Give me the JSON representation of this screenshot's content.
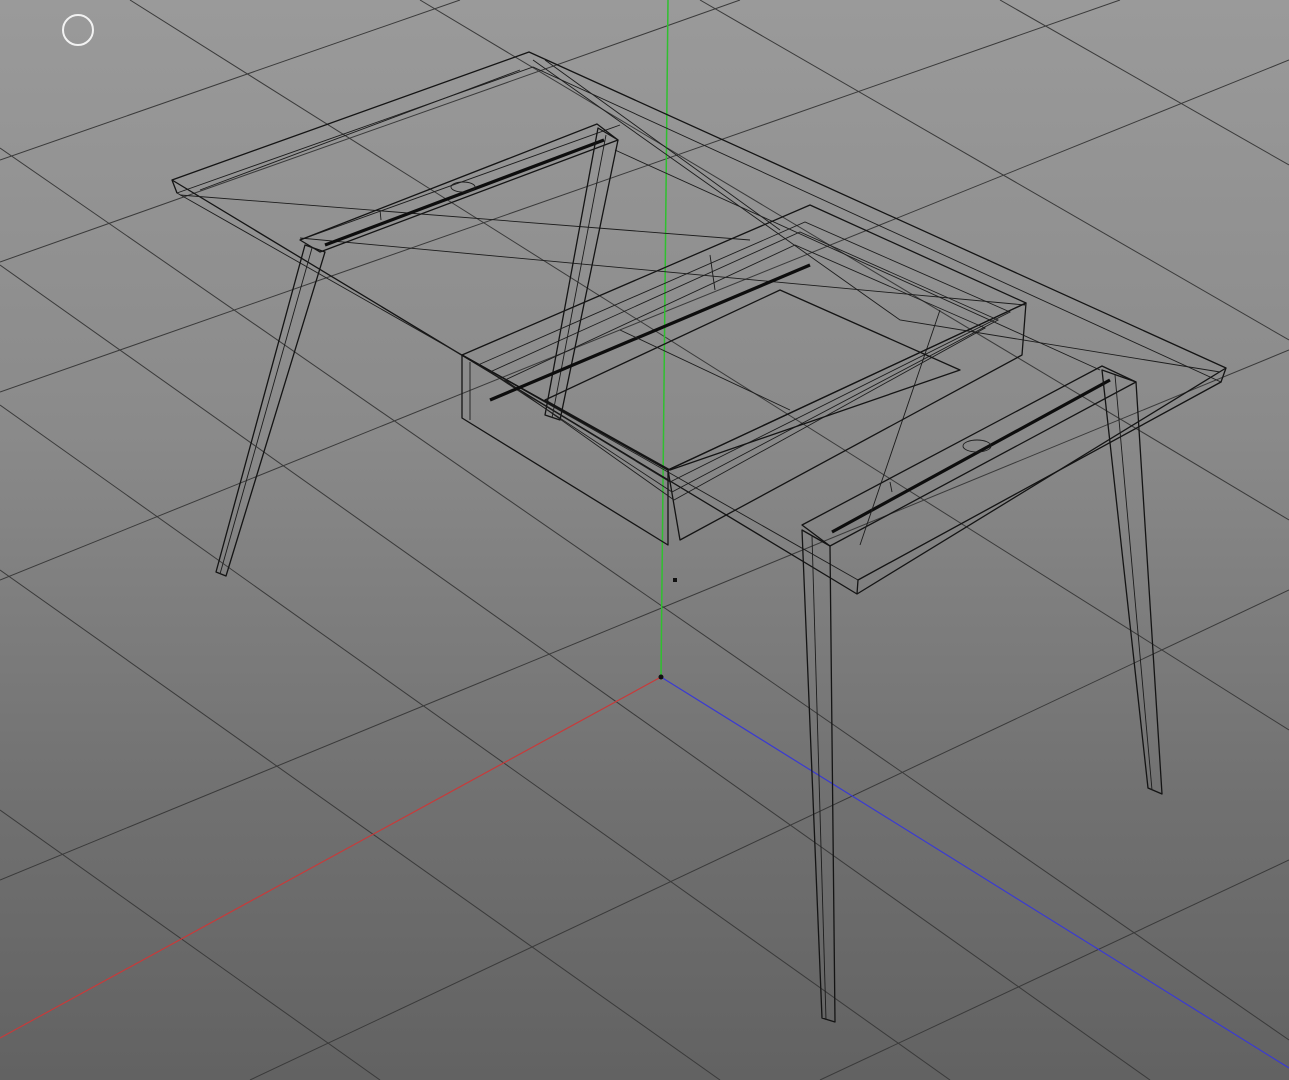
{
  "viewport": {
    "view": "perspective",
    "shading": "wireframe",
    "background_top": "#9a9a9a",
    "background_bottom": "#626262"
  },
  "axes": {
    "x_color": "#c83a3a",
    "y_color": "#2fc02f",
    "z_color": "#3a3ad2"
  },
  "grid": {
    "color": "#3a3a3a",
    "visible": true
  },
  "wireframe": {
    "color": "#141414",
    "object": "table-with-drawer"
  },
  "gizmo": {
    "icon": "orbit-circle-icon",
    "color": "#f2f2f2"
  }
}
